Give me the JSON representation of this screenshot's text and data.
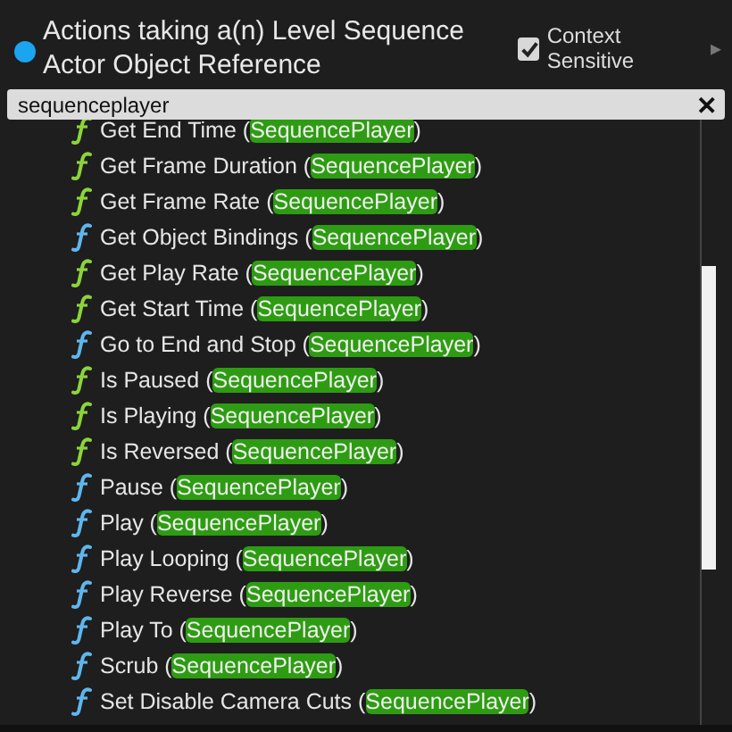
{
  "header": {
    "title": "Actions taking a(n) Level Sequence Actor Object Reference",
    "context_sensitive": {
      "label": "Context Sensitive",
      "checked": true
    },
    "expand_arrow": "▸"
  },
  "search": {
    "value": "sequenceplayer",
    "clear": "✕"
  },
  "actions": [
    {
      "kind": "pure",
      "prefix": "Get End Time (",
      "match": "SequencePlayer",
      "suffix": ")"
    },
    {
      "kind": "pure",
      "prefix": "Get Frame Duration (",
      "match": "SequencePlayer",
      "suffix": ")"
    },
    {
      "kind": "pure",
      "prefix": "Get Frame Rate (",
      "match": "SequencePlayer",
      "suffix": ")"
    },
    {
      "kind": "impure",
      "prefix": "Get Object Bindings (",
      "match": "SequencePlayer",
      "suffix": ")"
    },
    {
      "kind": "pure",
      "prefix": "Get Play Rate (",
      "match": "SequencePlayer",
      "suffix": ")"
    },
    {
      "kind": "pure",
      "prefix": "Get Start Time (",
      "match": "SequencePlayer",
      "suffix": ")"
    },
    {
      "kind": "impure",
      "prefix": "Go to End and Stop (",
      "match": "SequencePlayer",
      "suffix": ")"
    },
    {
      "kind": "pure",
      "prefix": "Is Paused (",
      "match": "SequencePlayer",
      "suffix": ")"
    },
    {
      "kind": "pure",
      "prefix": "Is Playing (",
      "match": "SequencePlayer",
      "suffix": ")"
    },
    {
      "kind": "pure",
      "prefix": "Is Reversed (",
      "match": "SequencePlayer",
      "suffix": ")"
    },
    {
      "kind": "impure",
      "prefix": "Pause (",
      "match": "SequencePlayer",
      "suffix": ")"
    },
    {
      "kind": "impure",
      "prefix": "Play (",
      "match": "SequencePlayer",
      "suffix": ")"
    },
    {
      "kind": "impure",
      "prefix": "Play Looping (",
      "match": "SequencePlayer",
      "suffix": ")"
    },
    {
      "kind": "impure",
      "prefix": "Play Reverse (",
      "match": "SequencePlayer",
      "suffix": ")"
    },
    {
      "kind": "impure",
      "prefix": "Play To (",
      "match": "SequencePlayer",
      "suffix": ")"
    },
    {
      "kind": "impure",
      "prefix": "Scrub (",
      "match": "SequencePlayer",
      "suffix": ")"
    },
    {
      "kind": "impure",
      "prefix": "Set Disable Camera Cuts (",
      "match": "SequencePlayer",
      "suffix": ")"
    }
  ]
}
